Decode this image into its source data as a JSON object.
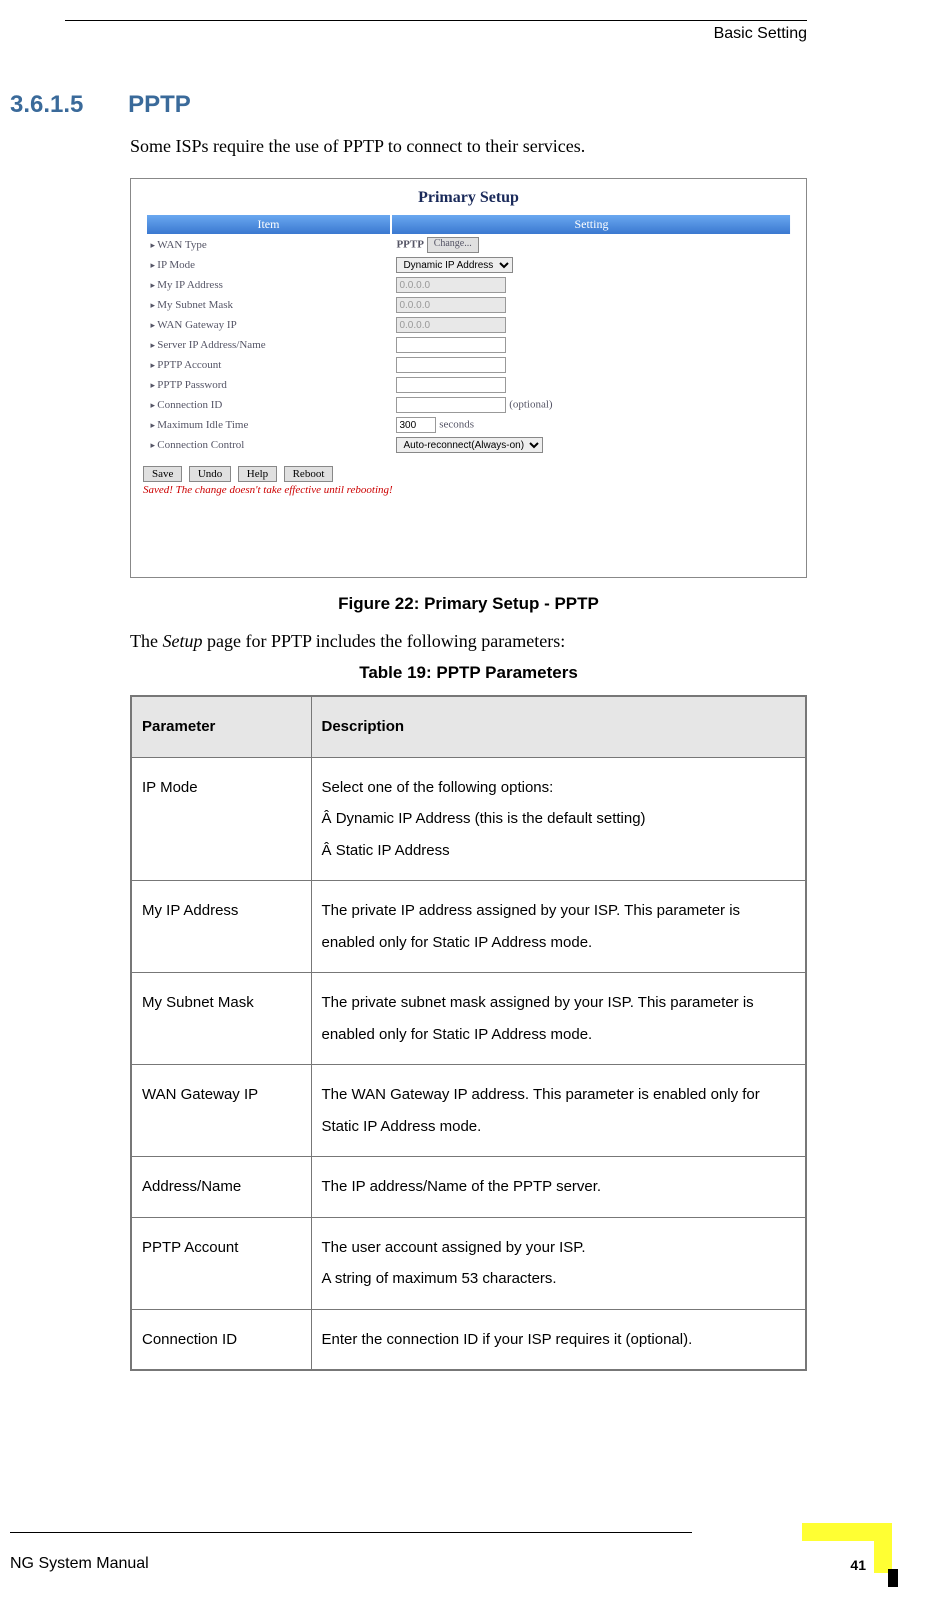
{
  "header": {
    "right": "Basic Setting"
  },
  "section": {
    "number": "3.6.1.5",
    "title": "PPTP"
  },
  "intro": "Some ISPs require the use of PPTP to connect to their services.",
  "screenshot": {
    "title": "Primary Setup",
    "cols": {
      "item": "Item",
      "setting": "Setting"
    },
    "rows": {
      "wan_type": "WAN Type",
      "ip_mode": "IP Mode",
      "my_ip": "My IP Address",
      "my_subnet": "My Subnet Mask",
      "wan_gw": "WAN Gateway IP",
      "server": "Server IP Address/Name",
      "account": "PPTP Account",
      "password": "PPTP Password",
      "conn_id": "Connection ID",
      "max_idle": "Maximum Idle Time",
      "conn_ctrl": "Connection Control"
    },
    "values": {
      "wan_type_val": "PPTP",
      "change_btn": "Change...",
      "ip_mode_sel": "Dynamic IP Address",
      "ip_placeholder": "0.0.0.0",
      "optional": "(optional)",
      "idle_val": "300",
      "idle_unit": "seconds",
      "conn_ctrl_sel": "Auto-reconnect(Always-on)"
    },
    "buttons": {
      "save": "Save",
      "undo": "Undo",
      "help": "Help",
      "reboot": "Reboot"
    },
    "warning": "Saved! The change doesn't take effective until rebooting!"
  },
  "figure_caption": "Figure 22: Primary Setup - PPTP",
  "para2_a": "The ",
  "para2_i": "Setup",
  "para2_b": " page for PPTP includes the following parameters:",
  "table_caption": "Table 19: PPTP Parameters",
  "table": {
    "h1": "Parameter",
    "h2": "Description",
    "r1p": "IP Mode",
    "r1d1": "Select one of the following options:",
    "r1d2": "Dynamic IP Address (this is the default setting)",
    "r1d3": "Static IP Address",
    "r2p": "My IP Address",
    "r2d": "The private IP address assigned by your ISP. This parameter is enabled only for Static IP Address mode.",
    "r3p": "My Subnet Mask",
    "r3d": "The private subnet mask assigned by your ISP. This parameter is enabled only for Static IP Address mode.",
    "r4p": "WAN Gateway IP",
    "r4d": "The WAN Gateway IP address. This parameter is enabled only for Static IP Address mode.",
    "r5p": "Address/Name",
    "r5d": "The IP address/Name of the PPTP server.",
    "r6p": "PPTP Account",
    "r6d1": "The user account assigned by your ISP.",
    "r6d2": "A string of maximum 53 characters.",
    "r7p": "Connection ID",
    "r7d": "Enter the connection ID if your ISP requires it (optional)."
  },
  "footer": {
    "left": "NG System Manual",
    "page": "41"
  }
}
